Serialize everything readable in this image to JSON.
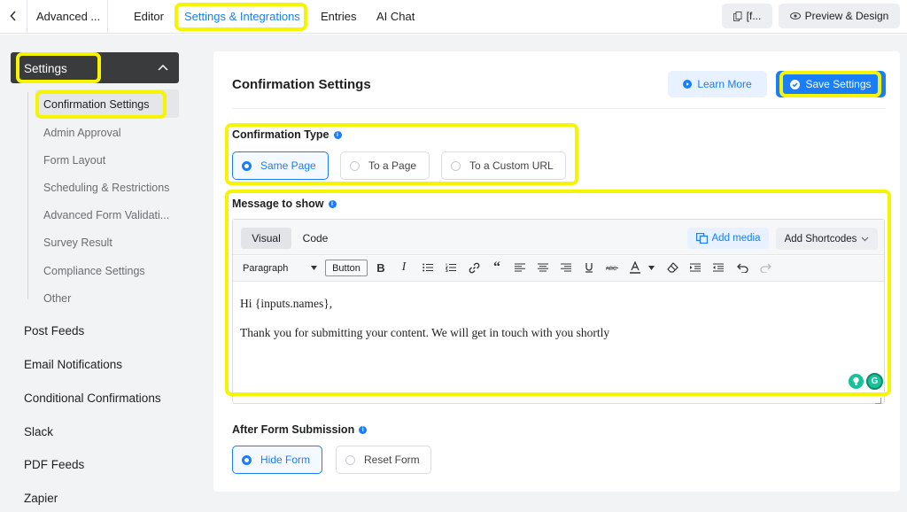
{
  "topbar": {
    "back_icon": "chevron-left-icon",
    "title": "Advanced ...",
    "tabs": [
      {
        "label": "Editor"
      },
      {
        "label": "Settings & Integrations"
      },
      {
        "label": "Entries"
      },
      {
        "label": "AI Chat"
      }
    ],
    "shortcode_button": "[f...",
    "preview_button": "Preview & Design"
  },
  "sidebar": {
    "header_label": "Settings",
    "sub_items": [
      {
        "label": "Confirmation Settings"
      },
      {
        "label": "Admin Approval"
      },
      {
        "label": "Form Layout"
      },
      {
        "label": "Scheduling & Restrictions"
      },
      {
        "label": "Advanced Form Validati..."
      },
      {
        "label": "Survey Result"
      },
      {
        "label": "Compliance Settings"
      },
      {
        "label": "Other"
      }
    ],
    "main_items": [
      {
        "label": "Post Feeds"
      },
      {
        "label": "Email Notifications"
      },
      {
        "label": "Conditional Confirmations"
      },
      {
        "label": "Slack"
      },
      {
        "label": "PDF Feeds"
      },
      {
        "label": "Zapier"
      }
    ]
  },
  "main": {
    "title": "Confirmation Settings",
    "learn_more": "Learn More",
    "save_settings": "Save Settings",
    "confirmation_type": {
      "label": "Confirmation Type",
      "options": [
        {
          "label": "Same Page",
          "selected": true
        },
        {
          "label": "To a Page",
          "selected": false
        },
        {
          "label": "To a Custom URL",
          "selected": false
        }
      ]
    },
    "message": {
      "label": "Message to show",
      "tabs": [
        {
          "label": "Visual"
        },
        {
          "label": "Code"
        }
      ],
      "add_media": "Add media",
      "add_shortcodes": "Add Shortcodes",
      "format_select": "Paragraph",
      "button_label": "Button",
      "body_lines": [
        "Hi {inputs.names},",
        "Thank you for submitting your content. We will get in touch with you shortly"
      ]
    },
    "after_submission": {
      "label": "After Form Submission",
      "options": [
        {
          "label": "Hide Form",
          "selected": true
        },
        {
          "label": "Reset Form",
          "selected": false
        }
      ]
    }
  },
  "colors": {
    "accent": "#1a7efb",
    "highlight": "#f5f500",
    "sidebar_header": "#3a3b3d",
    "background": "#f2f3f5"
  }
}
